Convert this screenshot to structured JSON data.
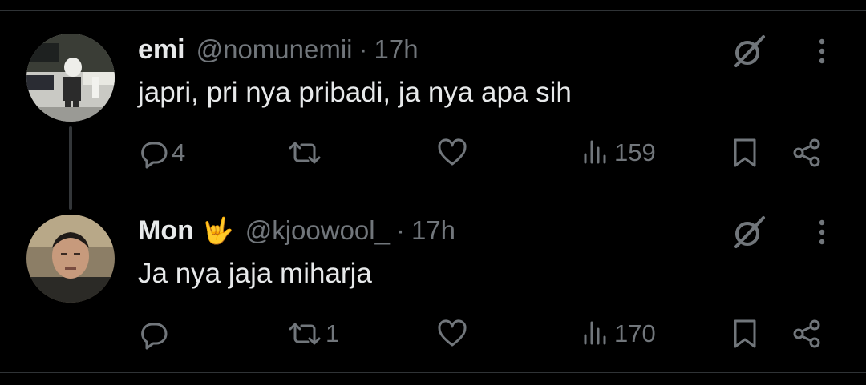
{
  "posts": [
    {
      "name": "emi",
      "emoji": "",
      "handle": "@nomunemii",
      "separator": "·",
      "time": "17h",
      "text": "japri, pri nya pribadi, ja nya apa sih",
      "replies": "4",
      "reposts": "",
      "likes": "",
      "views": "159"
    },
    {
      "name": "Mon",
      "emoji": "🤟",
      "handle": "@kjoowool_",
      "separator": "·",
      "time": "17h",
      "text": "Ja nya jaja miharja",
      "replies": "",
      "reposts": "1",
      "likes": "",
      "views": "170"
    }
  ],
  "colors": {
    "background": "#000000",
    "text": "#e7e9ea",
    "muted": "#71767b",
    "divider": "#2f3336"
  },
  "icons": [
    "grok-icon",
    "more-icon",
    "reply-icon",
    "repost-icon",
    "like-icon",
    "views-icon",
    "bookmark-icon",
    "share-icon"
  ]
}
